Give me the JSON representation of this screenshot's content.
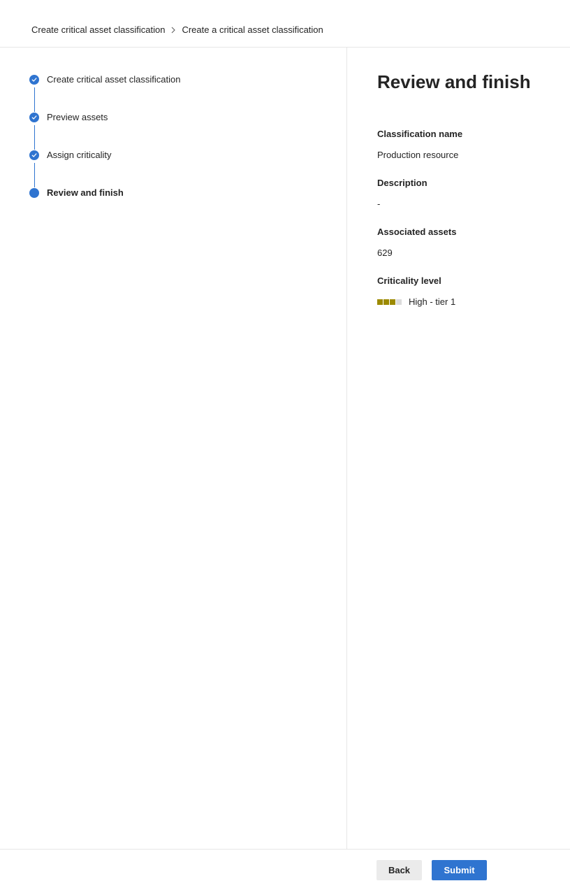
{
  "breadcrumb": {
    "items": [
      {
        "label": "Create critical asset classification"
      },
      {
        "label": "Create a critical asset classification"
      }
    ]
  },
  "stepper": {
    "steps": [
      {
        "label": "Create critical asset classification",
        "state": "completed"
      },
      {
        "label": "Preview assets",
        "state": "completed"
      },
      {
        "label": "Assign criticality",
        "state": "completed"
      },
      {
        "label": "Review and finish",
        "state": "current"
      }
    ]
  },
  "panel": {
    "title": "Review and finish",
    "fields": [
      {
        "label": "Classification name",
        "value": "Production resource"
      },
      {
        "label": "Description",
        "value": "-"
      },
      {
        "label": "Associated assets",
        "value": "629"
      },
      {
        "label": "Criticality level",
        "value": "High - tier 1",
        "level": 3,
        "max_level": 4
      }
    ]
  },
  "footer": {
    "back_label": "Back",
    "submit_label": "Submit"
  },
  "colors": {
    "accent": "#2f74d0",
    "criticality_high": "#9c8a00",
    "criticality_off": "#dcdcdc"
  },
  "icons": {
    "step_completed": "checkmark-icon",
    "breadcrumb_separator": "chevron-right-icon"
  }
}
